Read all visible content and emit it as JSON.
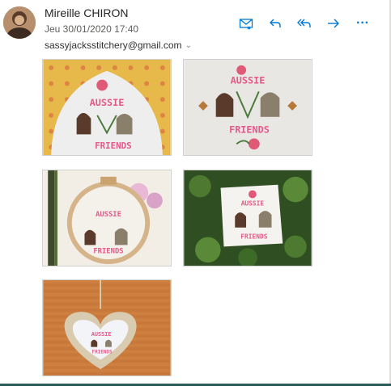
{
  "sender": {
    "name": "Mireille CHIRON",
    "date": "Jeu 30/01/2020 17:40",
    "to": "sassyjacksstitchery@gmail.com"
  },
  "icons": {
    "actions": [
      "read-receipt-icon",
      "reply-icon",
      "reply-all-icon",
      "forward-icon",
      "more-icon"
    ],
    "more": "···",
    "chevron": "⌄"
  },
  "colors": {
    "accent": "#0078d4",
    "bottom_bar": "#2e5b5a"
  },
  "attachments": [
    {
      "name": "cushion-ornament-on-yellow-cloth",
      "stitched_text": [
        "AUSSIE",
        "FRIENDS"
      ]
    },
    {
      "name": "flat-stitched-piece",
      "stitched_text": [
        "AUSSIE",
        "FRIENDS"
      ]
    },
    {
      "name": "embroidery-hoop-with-orchid",
      "stitched_text": [
        "AUSSIE",
        "FRIENDS"
      ]
    },
    {
      "name": "pillow-ornament-in-bush",
      "stitched_text": [
        "AUSSIE",
        "FRIENDS"
      ]
    },
    {
      "name": "heart-frame-ornament",
      "stitched_text": [
        "AUSSIE",
        "FRIENDS"
      ]
    }
  ]
}
